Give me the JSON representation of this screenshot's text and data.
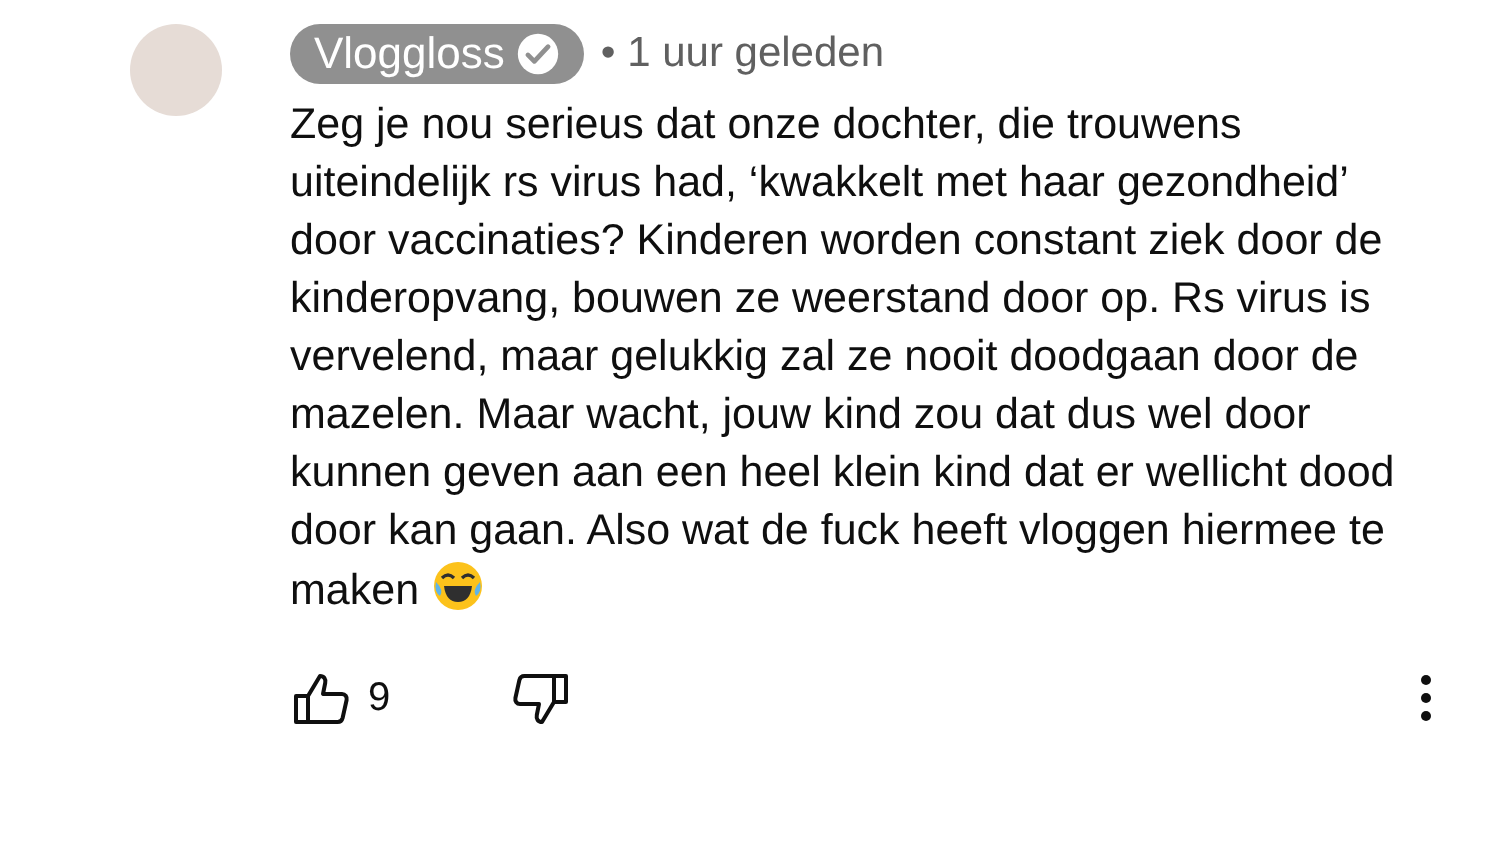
{
  "comment": {
    "author": "Vloggloss",
    "author_verified": true,
    "time": "• 1 uur geleden",
    "text": "Zeg je nou serieus dat onze dochter, die trouwens uiteindelijk rs virus had, ‘kwakkelt met haar gezondheid’ door vaccinaties? Kinderen worden constant ziek door de kinderopvang, bouwen ze weerstand door op. Rs virus is vervelend, maar gelukkig zal ze nooit doodgaan door de mazelen. Maar wacht, jouw kind zou dat dus wel door kunnen geven aan een heel klein kind dat er wellicht dood door kan gaan. Also wat de fuck heeft vloggen hiermee te maken",
    "likes": "9"
  }
}
